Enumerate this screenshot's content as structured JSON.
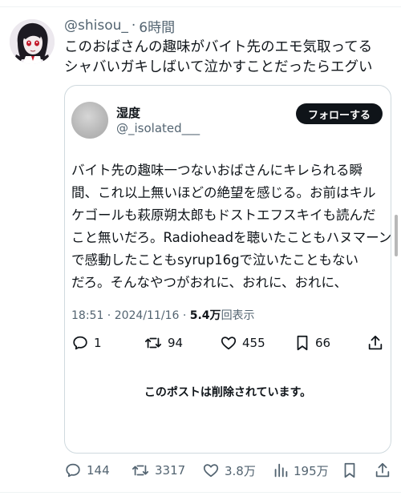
{
  "tweet": {
    "handle": "@shisou_",
    "separator": "·",
    "time": "6時間",
    "text_lines": [
      "このおばさんの趣味がバイト先のエモ気取ってる",
      "シャバいガキしばいて泣かすことだったらエグい"
    ]
  },
  "quote": {
    "name": "湿度",
    "handle": "@_isolated___",
    "follow_label": "フォローする",
    "text_lines": [
      "バイト先の趣味一つないおばさんにキレられる瞬",
      "間、これ以上無いほどの絶望を感じる。お前はキル",
      "ケゴールも萩原朔太郎もドストエフスキイも読んだ",
      "こと無いだろ。Radioheadを聴いたこともハヌマーン",
      "で感動したこともsyrup16gで泣いたこともない",
      "だろ。そんなやつがおれに、おれに、おれに、"
    ],
    "meta_time": "18:51 · 2024/11/16 · ",
    "views_count": "5.4万",
    "views_label": "回表示",
    "replies": "1",
    "retweets": "94",
    "likes": "455",
    "bookmarks": "66",
    "deleted_notice": "このポストは削除されています。"
  },
  "actions": {
    "replies": "144",
    "retweets": "3317",
    "likes": "3.8万",
    "views": "195万"
  },
  "colors": {
    "text": "#0f1419",
    "secondary": "#536471",
    "border": "#cfd9de",
    "follow_bg": "#0f1419"
  },
  "icons": [
    "reply-icon",
    "retweet-icon",
    "like-icon",
    "bookmark-icon",
    "share-icon",
    "views-icon"
  ]
}
